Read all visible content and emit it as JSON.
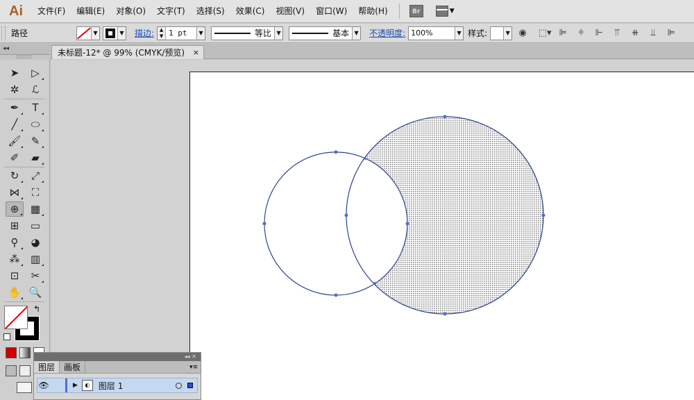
{
  "app": {
    "logo": "Ai",
    "bridge_label": "Br"
  },
  "menu": [
    "文件(F)",
    "编辑(E)",
    "对象(O)",
    "文字(T)",
    "选择(S)",
    "效果(C)",
    "视图(V)",
    "窗口(W)",
    "帮助(H)"
  ],
  "control": {
    "selection_label": "路径",
    "stroke_link": "描边:",
    "stroke_weight": "1 pt",
    "variable_width": "等比",
    "brush_def": "基本",
    "opacity_link": "不透明度:",
    "opacity_value": "100%",
    "style_label": "样式:"
  },
  "tools_header": "◂◂",
  "document": {
    "tab_title": "未标题-12* @ 99% (CMYK/预览)",
    "close": "×"
  },
  "layers": {
    "header_collapse": "◂◂  ✕",
    "tab_layers": "图层",
    "tab_artboards": "画板",
    "menu": "▾≡",
    "layer_name": "图层 1"
  },
  "colors": {
    "accent_link": "#1a4fb0",
    "path_stroke": "#2b3f8c",
    "anchor": "#4f6bd8",
    "fill_pattern": "#8a8a8a",
    "layer_row": "#c5d8f0"
  },
  "shapes": {
    "left_circle": "stroke-only circle",
    "right_circle": "crescent filled with dot pattern"
  }
}
